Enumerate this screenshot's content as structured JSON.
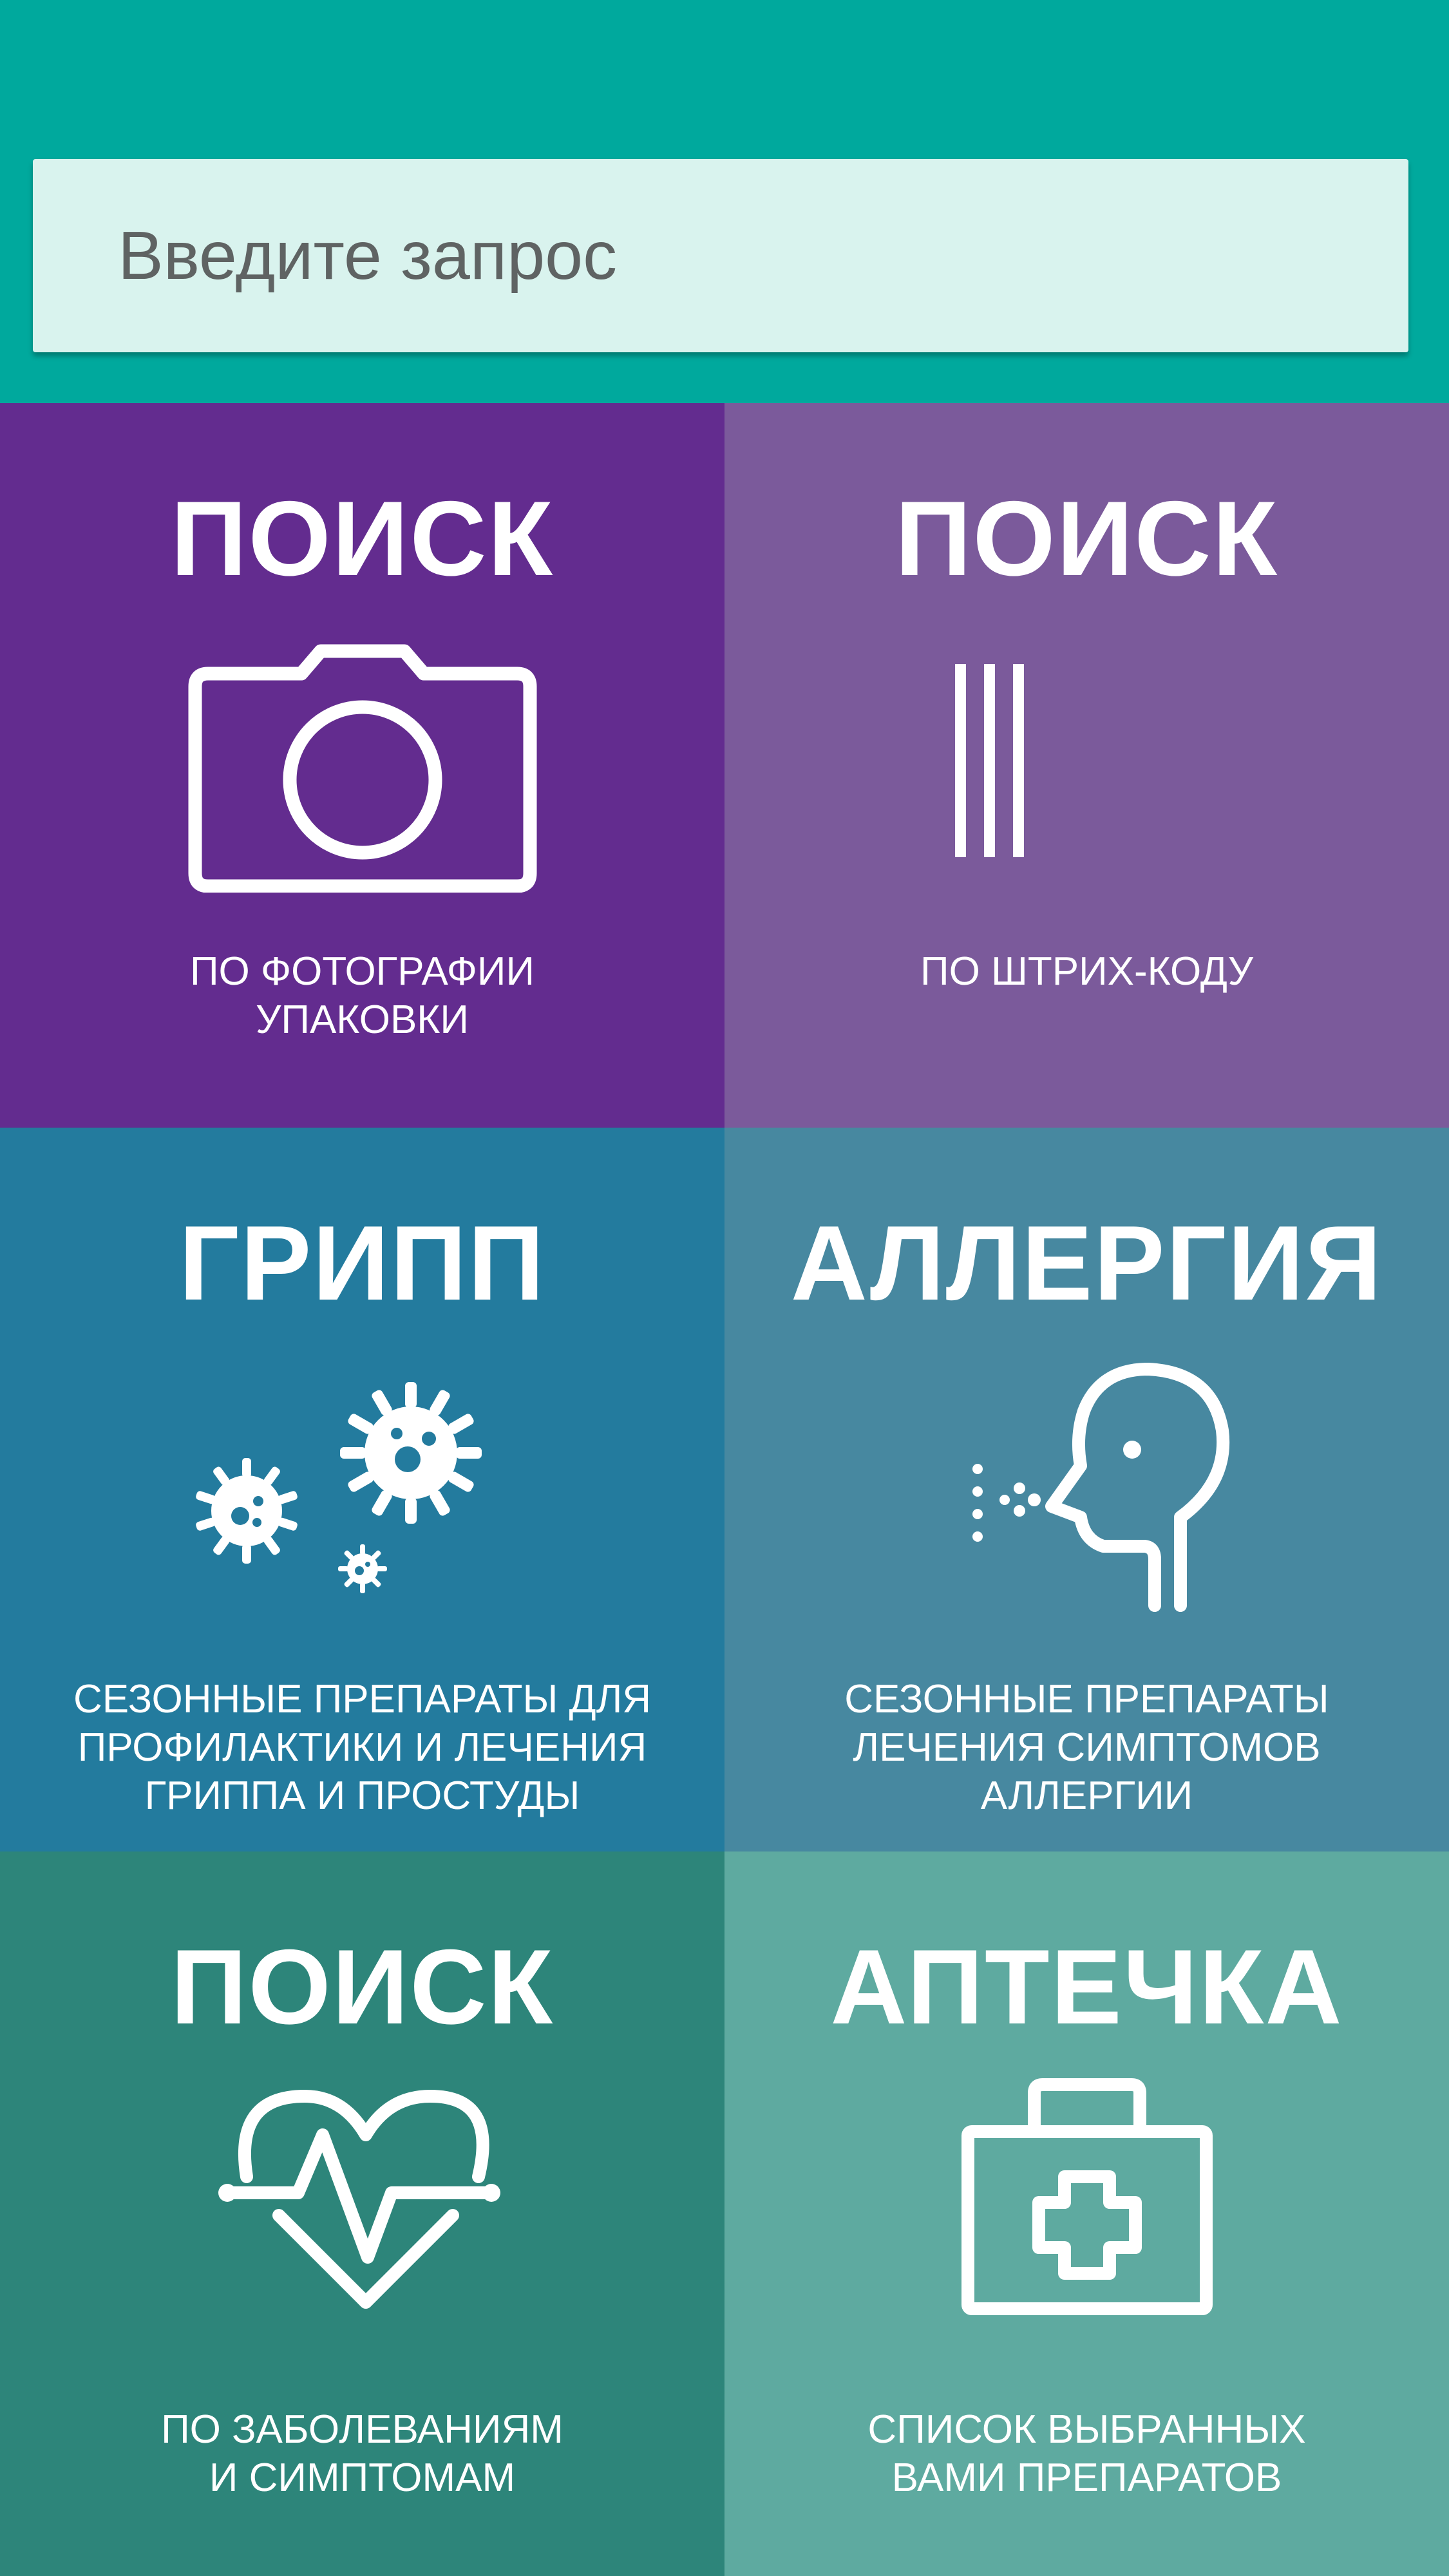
{
  "search": {
    "placeholder": "Введите запрос"
  },
  "tiles": [
    {
      "title": "ПОИСК",
      "description": "ПО ФОТОГРАФИИ\nУПАКОВКИ",
      "icon": "camera-icon",
      "color": "#632c8f"
    },
    {
      "title": "ПОИСК",
      "description": "ПО ШТРИХ-КОДУ",
      "icon": "barcode-icon",
      "color": "#7b5a9b"
    },
    {
      "title": "ГРИПП",
      "description": "СЕЗОННЫЕ ПРЕПАРАТЫ ДЛЯ\nПРОФИЛАКТИКИ И ЛЕЧЕНИЯ\nГРИППА И ПРОСТУДЫ",
      "icon": "virus-icon",
      "color": "#237b9e"
    },
    {
      "title": "АЛЛЕРГИЯ",
      "description": "СЕЗОННЫЕ ПРЕПАРАТЫ\nЛЕЧЕНИЯ СИМПТОМОВ\nАЛЛЕРГИИ",
      "icon": "sneezing-head-icon",
      "color": "#4788a0"
    },
    {
      "title": "ПОИСК",
      "description": "ПО ЗАБОЛЕВАНИЯМ\nИ СИМПТОМАМ",
      "icon": "heartbeat-icon",
      "color": "#2d857a"
    },
    {
      "title": "АПТЕЧКА",
      "description": "СПИСОК ВЫБРАННЫХ\nВАМИ ПРЕПАРАТОВ",
      "icon": "first-aid-kit-icon",
      "color": "#5eaaa0"
    }
  ]
}
